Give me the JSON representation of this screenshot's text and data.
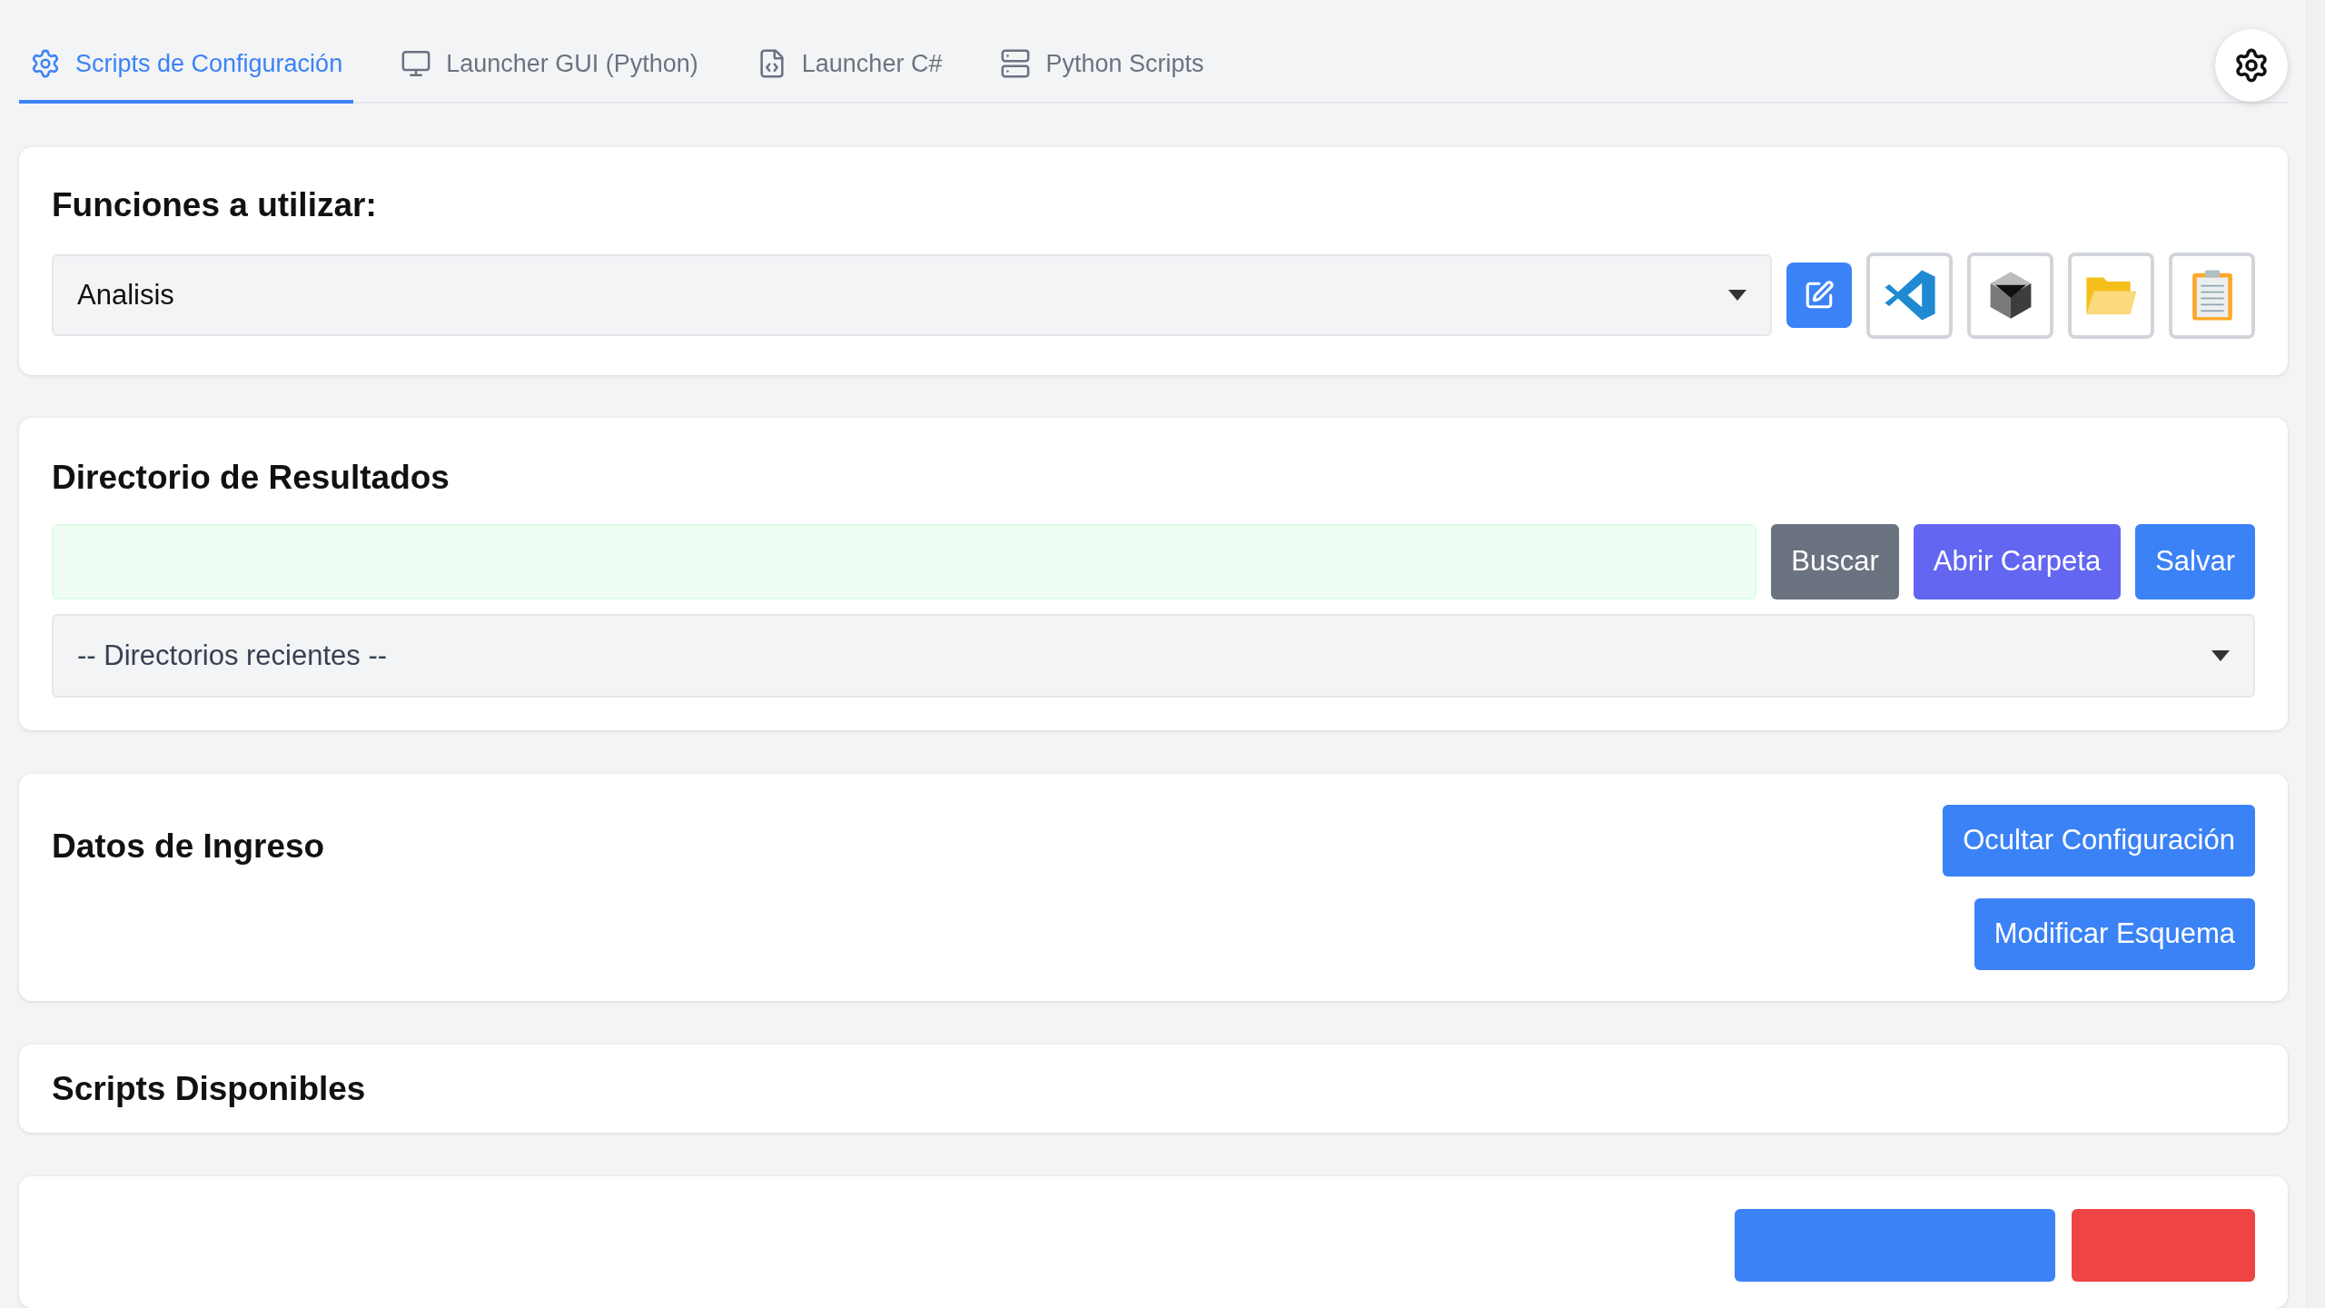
{
  "tabs": [
    {
      "label": "Scripts de Configuración",
      "kind": "gear",
      "selected": true
    },
    {
      "label": "Launcher GUI (Python)",
      "kind": "monitor",
      "selected": false
    },
    {
      "label": "Launcher C#",
      "kind": "file",
      "selected": false
    },
    {
      "label": "Python Scripts",
      "kind": "server",
      "selected": false
    }
  ],
  "functions_card": {
    "title": "Funciones a utilizar:",
    "select": {
      "value": "Analisis"
    },
    "tools": [
      {
        "kind": "edit"
      },
      {
        "kind": "code"
      },
      {
        "kind": "cube"
      },
      {
        "kind": "folder"
      },
      {
        "kind": "clipboard"
      }
    ]
  },
  "results_card": {
    "title": "Directorio de Resultados",
    "buttons": [
      {
        "label": "Buscar",
        "kind": "secondary"
      },
      {
        "label": "Abrir Carpeta",
        "kind": "accent"
      },
      {
        "label": "Salvar",
        "kind": "primary"
      }
    ],
    "recent_select": {
      "value": "-- Directorios recientes --"
    }
  },
  "input_card": {
    "title": "Datos de Ingreso",
    "buttons": [
      {
        "label": "Ocultar Configuración"
      },
      {
        "label": "Modificar Esquema"
      }
    ]
  },
  "scripts_card": {
    "title": "Scripts Disponibles"
  },
  "bottom_card": {
    "buttons": [
      {
        "kind": "primary"
      },
      {
        "kind": "danger"
      }
    ]
  }
}
